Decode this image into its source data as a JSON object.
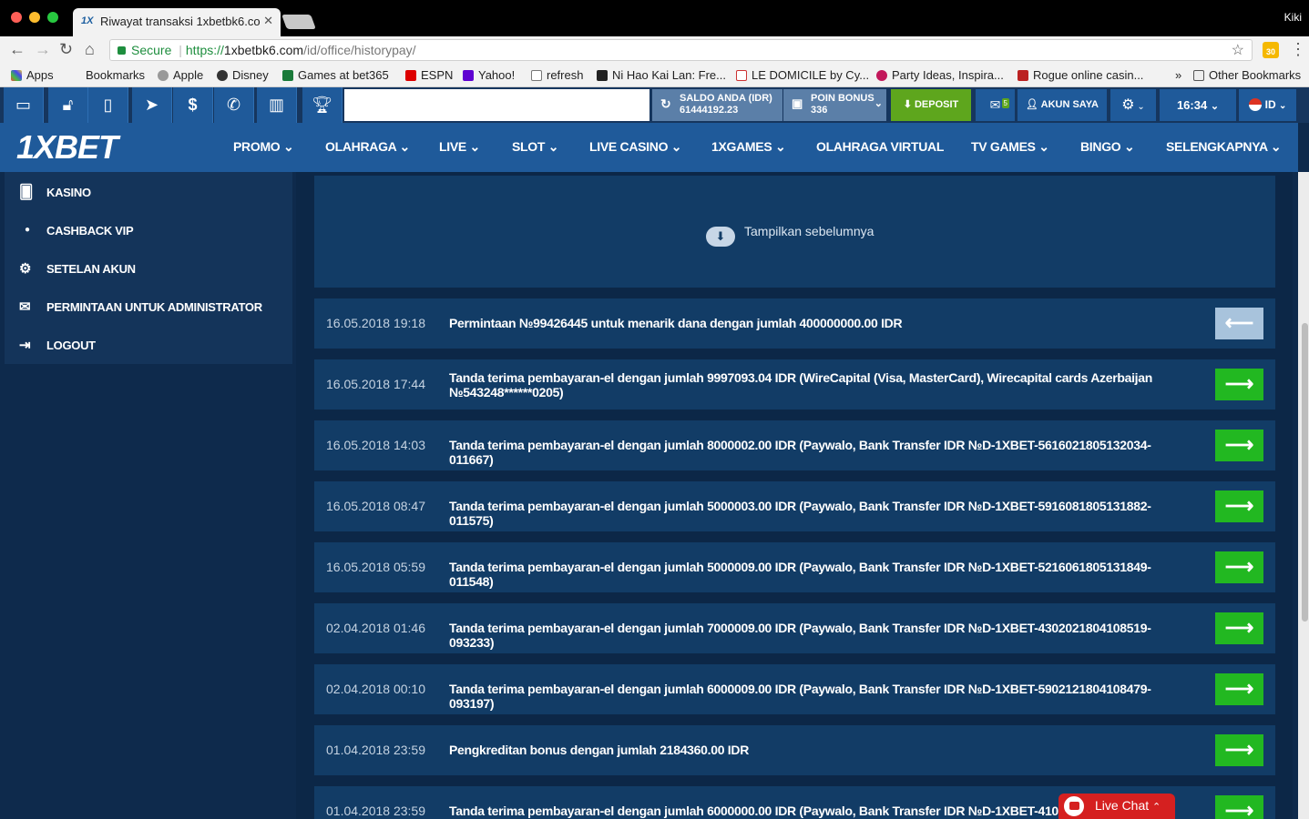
{
  "browser": {
    "tab_title": "Riwayat transaksi 1xbetbk6.co",
    "tab_favicon": "1X",
    "profile": "Kiki",
    "secure_label": "Secure",
    "url_scheme": "https://",
    "url_host": "1xbetbk6.com",
    "url_path": "/id/office/historypay/",
    "extension_badge": "30",
    "bookmarks": [
      "Apps",
      "Bookmarks",
      "Apple",
      "Disney",
      "Games at bet365",
      "ESPN",
      "Yahoo!",
      "refresh",
      "Ni Hao Kai Lan: Fre...",
      "LE DOMICILE by Cy...",
      "Party Ideas, Inspira...",
      "Rogue online casin...",
      "»",
      "Other Bookmarks"
    ]
  },
  "topbar": {
    "balance_label": "SALDO ANDA (IDR)",
    "balance_value": "61444192.23",
    "bonus_label": "POIN BONUS",
    "bonus_value": "336",
    "deposit_label": "DEPOSIT",
    "mail_count": "5",
    "account_label": "AKUN SAYA",
    "time": "16:34",
    "language": "ID"
  },
  "nav": {
    "logo_one": "1X",
    "logo_bet": "BET",
    "items": [
      "PROMO",
      "OLAHRAGA",
      "LIVE",
      "SLOT",
      "LIVE CASINO",
      "1XGAMES",
      "OLAHRAGA VIRTUAL",
      "TV GAMES",
      "BINGO",
      "SELENGKAPNYA"
    ]
  },
  "sidebar": {
    "items": [
      "KASINO",
      "CASHBACK VIP",
      "SETELAN AKUN",
      "PERMINTAAN UNTUK ADMINISTRATOR",
      "LOGOUT"
    ]
  },
  "history": {
    "show_previous": "Tampilkan sebelumnya",
    "rows": [
      {
        "date": "16.05.2018 19:18",
        "desc": "Permintaan №99426445 untuk menarik dana dengan jumlah 400000000.00 IDR"
      },
      {
        "date": "16.05.2018 17:44",
        "desc": "Tanda terima pembayaran-el dengan jumlah 9997093.04 IDR (WireCapital (Visa, MasterCard), Wirecapital cards Azerbaijan №543248******0205)"
      },
      {
        "date": "16.05.2018 14:03",
        "desc": "Tanda terima pembayaran-el dengan jumlah 8000002.00 IDR (Paywalo, Bank Transfer IDR №D-1XBET-5616021805132034-011667)"
      },
      {
        "date": "16.05.2018 08:47",
        "desc": "Tanda terima pembayaran-el dengan jumlah 5000003.00 IDR (Paywalo, Bank Transfer IDR №D-1XBET-5916081805131882-011575)"
      },
      {
        "date": "16.05.2018 05:59",
        "desc": "Tanda terima pembayaran-el dengan jumlah 5000009.00 IDR (Paywalo, Bank Transfer IDR №D-1XBET-5216061805131849-011548)"
      },
      {
        "date": "02.04.2018 01:46",
        "desc": "Tanda terima pembayaran-el dengan jumlah 7000009.00 IDR (Paywalo, Bank Transfer IDR №D-1XBET-4302021804108519-093233)"
      },
      {
        "date": "02.04.2018 00:10",
        "desc": "Tanda terima pembayaran-el dengan jumlah 6000009.00 IDR (Paywalo, Bank Transfer IDR №D-1XBET-5902121804108479-093197)"
      },
      {
        "date": "01.04.2018 23:59",
        "desc": "Pengkreditan bonus dengan jumlah 2184360.00 IDR"
      },
      {
        "date": "01.04.2018 23:59",
        "desc": "Tanda terima pembayaran-el dengan jumlah 6000000.00 IDR (Paywalo, Bank Transfer IDR №D-1XBET-410210"
      }
    ]
  },
  "livechat": {
    "label": "Live Chat"
  }
}
